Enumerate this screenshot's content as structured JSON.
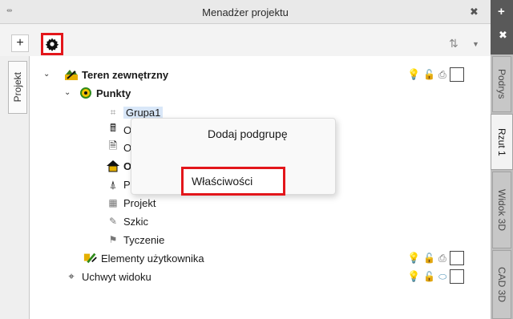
{
  "window": {
    "title": "Menadżer projektu"
  },
  "right_tabs": [
    {
      "label": "Podrys"
    },
    {
      "label": "Rzut 1"
    },
    {
      "label": "Widok 3D"
    },
    {
      "label": "CAD 3D"
    }
  ],
  "left_tab": {
    "label": "Projekt"
  },
  "toolbar": {
    "add_label": "+"
  },
  "tree": {
    "root": {
      "label": "Teren zewnętrzny"
    },
    "punkty": {
      "label": "Punkty"
    },
    "items": [
      {
        "label": "Grupa1"
      },
      {
        "label": "Oblic"
      },
      {
        "label": "Oper"
      },
      {
        "label": "Ośrodek"
      },
      {
        "label": "Pomiar"
      },
      {
        "label": "Projekt"
      },
      {
        "label": "Szkic"
      },
      {
        "label": "Tyczenie"
      }
    ],
    "elementy": {
      "label": "Elementy użytkownika"
    },
    "uchwyt": {
      "label": "Uchwyt widoku"
    }
  },
  "context_menu": {
    "items": [
      {
        "label": "Dodaj podgrupę"
      },
      {
        "label": "Właściwości"
      }
    ]
  },
  "colors": {
    "highlight": "#e3161b",
    "selection": "#d9e7f8"
  }
}
